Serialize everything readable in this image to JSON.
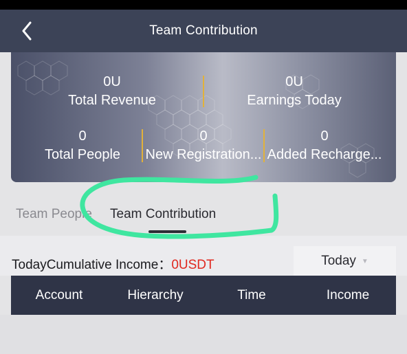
{
  "header": {
    "title": "Team Contribution",
    "back_icon": "chevron-left-icon"
  },
  "stats": {
    "total_revenue": {
      "value": "0U",
      "label": "Total Revenue"
    },
    "earnings_today": {
      "value": "0U",
      "label": "Earnings Today"
    },
    "total_people": {
      "value": "0",
      "label": "Total People"
    },
    "new_registration": {
      "value": "0",
      "label": "New Registration..."
    },
    "added_recharge": {
      "value": "0",
      "label": "Added Recharge..."
    }
  },
  "tabs": [
    {
      "label": "Team People",
      "active": false
    },
    {
      "label": "Team Contribution",
      "active": true
    }
  ],
  "income": {
    "label": "TodayCumulative Income：",
    "value": "0USDT"
  },
  "period_select": {
    "selected": "Today"
  },
  "table": {
    "columns": [
      "Account",
      "Hierarchy",
      "Time",
      "Income"
    ]
  },
  "colors": {
    "header_bg": "#3c4357",
    "accent_divider": "#e2b23a",
    "income_value": "#e0281f",
    "table_header_bg": "#2f3447",
    "annotation_stroke": "#3fe6a0"
  }
}
